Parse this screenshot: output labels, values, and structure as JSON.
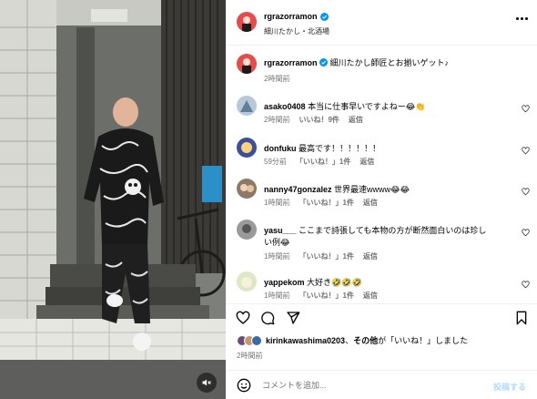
{
  "post": {
    "username": "rgrazorramon",
    "location": "細川たかし・北酒場",
    "caption": "細川たかし師匠とお揃いゲット♪",
    "caption_time": "2時間前"
  },
  "comments": [
    {
      "user": "asako0408",
      "text": "本当に仕事早いですよねー😂👏",
      "time": "2時間前",
      "likes": "いいね！9件",
      "reply": "返信"
    },
    {
      "user": "donfuku",
      "text": "最高です！！！！！！",
      "time": "59分前",
      "likes": "「いいね！」1件",
      "reply": "返信"
    },
    {
      "user": "nanny47gonzalez",
      "text": "世界最速wwww😂😂",
      "time": "1時間前",
      "likes": "「いいね！」1件",
      "reply": "返信"
    },
    {
      "user": "yasu___",
      "text": "ここまで詩張しても本物の方が断然面白いのは珍しい例😂",
      "time": "1時間前",
      "likes": "「いいね！」1件",
      "reply": "返信"
    },
    {
      "user": "yappekom",
      "text": "大好き🤣🤣🤣",
      "time": "1時間前",
      "likes": "「いいね！」1件",
      "reply": "返信"
    }
  ],
  "liked_by": {
    "user": "kirinkawashima0203",
    "sep": "、",
    "others": "その他",
    "suffix": "が「いいね！」しました",
    "time": "2時間前"
  },
  "comment_box": {
    "placeholder": "コメントを追加...",
    "post_label": "投稿する"
  },
  "colors": {
    "verified": "#0095f6",
    "post_disabled": "#b3dbff",
    "meta": "#737373"
  },
  "icons": [
    "verified-badge-icon",
    "more-icon",
    "heart-icon",
    "comment-icon",
    "share-icon",
    "bookmark-icon",
    "emoji-icon",
    "mute-icon"
  ]
}
